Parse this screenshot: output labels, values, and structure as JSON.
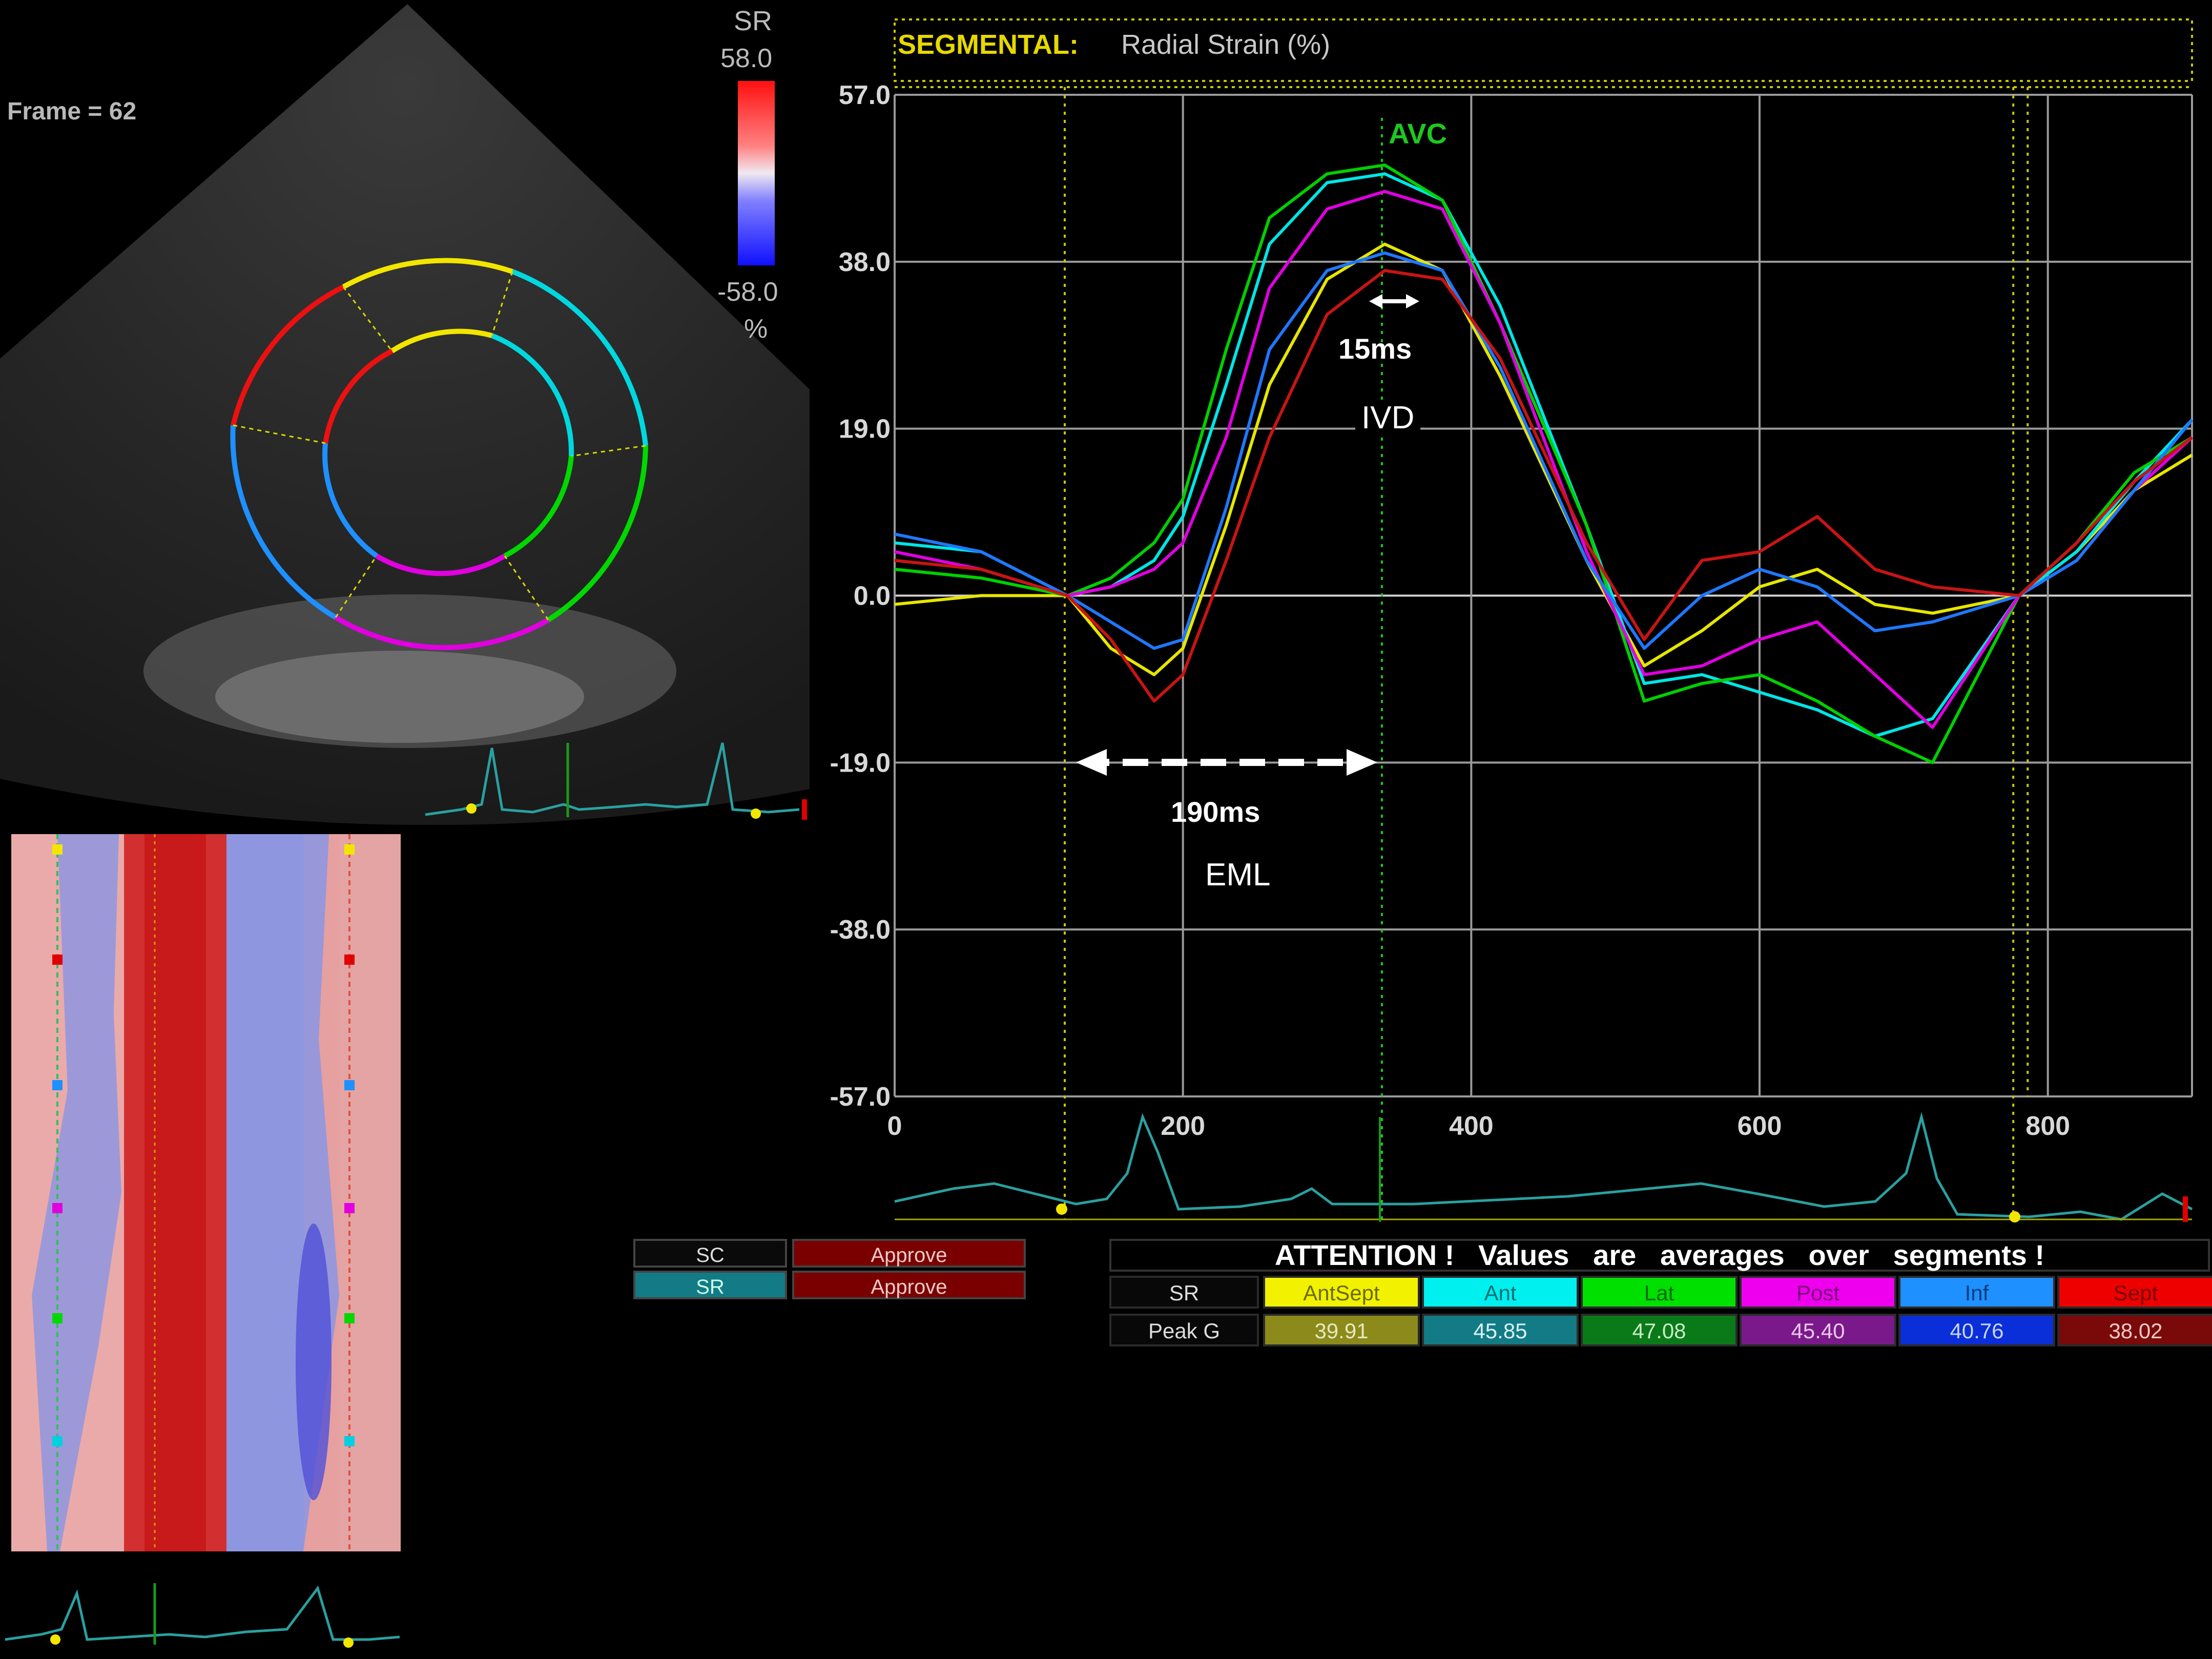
{
  "echo": {
    "frame_text": "Frame = 62",
    "scale_label": "SR",
    "scale_max": "58.0",
    "scale_min": "-58.0",
    "scale_unit": "%"
  },
  "graph": {
    "header_bold": "SEGMENTAL:",
    "header_rest": "Radial Strain (%)",
    "avc_label": "AVC",
    "annot_15ms": "15ms",
    "annot_ivd": "IVD",
    "annot_190ms": "190ms",
    "annot_eml": "EML",
    "y_tick_labels": [
      "57.0",
      "38.0",
      "19.0",
      "0.0",
      "-19.0",
      "-38.0",
      "-57.0"
    ],
    "x_tick_labels": [
      "0",
      "200",
      "400",
      "600",
      "800"
    ]
  },
  "controls": {
    "sc_label": "SC",
    "sr_label": "SR",
    "approve_1": "Approve",
    "approve_2": "Approve"
  },
  "table": {
    "attention": "ATTENTION !   Values   are   averages   over   segments !",
    "row1_label": "SR",
    "row2_label": "Peak G",
    "segments": [
      {
        "name": "AntSept",
        "value": "39.91",
        "head_bg": "#f2f200",
        "head_fg": "#6b6b00",
        "val_bg": "#8c8a1a",
        "val_fg": "#e8e8c0"
      },
      {
        "name": "Ant",
        "value": "45.85",
        "head_bg": "#00f0f0",
        "head_fg": "#007070",
        "val_bg": "#127b86",
        "val_fg": "#d8f4f4"
      },
      {
        "name": "Lat",
        "value": "47.08",
        "head_bg": "#00e000",
        "head_fg": "#006a00",
        "val_bg": "#0a7a18",
        "val_fg": "#c8ecc8"
      },
      {
        "name": "Post",
        "value": "45.40",
        "head_bg": "#ee00ee",
        "head_fg": "#7a007a",
        "val_bg": "#7a1a8a",
        "val_fg": "#ecc8ec"
      },
      {
        "name": "Inf",
        "value": "40.76",
        "head_bg": "#1e90ff",
        "head_fg": "#0a3c7a",
        "val_bg": "#0a2ed8",
        "val_fg": "#c8d4f8"
      },
      {
        "name": "Sept",
        "value": "38.02",
        "head_bg": "#ee0000",
        "head_fg": "#7a0000",
        "val_bg": "#7a0a0a",
        "val_fg": "#f4c8c8"
      }
    ]
  },
  "chart_data": {
    "type": "line",
    "title": "SEGMENTAL: Radial Strain (%)",
    "xlabel": "",
    "ylabel": "",
    "xlim": [
      0,
      900
    ],
    "ylim": [
      -57,
      57
    ],
    "grid": true,
    "series": [
      {
        "color": "#e6e600",
        "x": [
          0,
          60,
          120,
          150,
          180,
          200,
          230,
          260,
          300,
          340,
          380,
          420,
          480,
          520,
          560,
          600,
          640,
          680,
          720,
          780,
          820,
          860,
          900
        ],
        "y": [
          -1,
          0,
          0,
          -6,
          -9,
          -6,
          8,
          24,
          36,
          40,
          37,
          25,
          4,
          -8,
          -4,
          1,
          3,
          -1,
          -2,
          0,
          5,
          12,
          16
        ]
      },
      {
        "color": "#00e5e5",
        "x": [
          0,
          60,
          120,
          150,
          180,
          200,
          230,
          260,
          300,
          340,
          380,
          420,
          480,
          520,
          560,
          600,
          640,
          680,
          720,
          780,
          820,
          860,
          900
        ],
        "y": [
          6,
          5,
          0,
          1,
          4,
          9,
          24,
          40,
          47,
          48,
          45,
          33,
          8,
          -10,
          -9,
          -11,
          -13,
          -16,
          -14,
          0,
          5,
          13,
          20
        ]
      },
      {
        "color": "#00d000",
        "x": [
          0,
          60,
          120,
          150,
          180,
          200,
          230,
          260,
          300,
          340,
          380,
          420,
          480,
          520,
          560,
          600,
          640,
          680,
          720,
          780,
          820,
          860,
          900
        ],
        "y": [
          3,
          2,
          0,
          2,
          6,
          11,
          28,
          43,
          48,
          49,
          45,
          31,
          8,
          -12,
          -10,
          -9,
          -12,
          -16,
          -19,
          0,
          6,
          14,
          18
        ]
      },
      {
        "color": "#e000e0",
        "x": [
          0,
          60,
          120,
          150,
          180,
          200,
          230,
          260,
          300,
          340,
          380,
          420,
          480,
          520,
          560,
          600,
          640,
          680,
          720,
          780,
          820,
          860,
          900
        ],
        "y": [
          5,
          3,
          0,
          1,
          3,
          6,
          18,
          35,
          44,
          46,
          44,
          31,
          5,
          -9,
          -8,
          -5,
          -3,
          -9,
          -15,
          0,
          4,
          12,
          18
        ]
      },
      {
        "color": "#1e78ff",
        "x": [
          0,
          60,
          120,
          150,
          180,
          200,
          230,
          260,
          300,
          340,
          380,
          420,
          480,
          520,
          560,
          600,
          640,
          680,
          720,
          780,
          820,
          860,
          900
        ],
        "y": [
          7,
          5,
          0,
          -3,
          -6,
          -5,
          10,
          28,
          37,
          39,
          37,
          26,
          4,
          -6,
          0,
          3,
          1,
          -4,
          -3,
          0,
          4,
          12,
          20
        ]
      },
      {
        "color": "#c81414",
        "x": [
          0,
          60,
          120,
          150,
          180,
          200,
          230,
          260,
          300,
          340,
          380,
          420,
          480,
          520,
          560,
          600,
          640,
          680,
          720,
          780,
          820,
          860,
          900
        ],
        "y": [
          4,
          3,
          0,
          -5,
          -12,
          -9,
          4,
          18,
          32,
          37,
          36,
          27,
          6,
          -5,
          4,
          5,
          9,
          3,
          1,
          0,
          6,
          13,
          18
        ]
      }
    ]
  }
}
